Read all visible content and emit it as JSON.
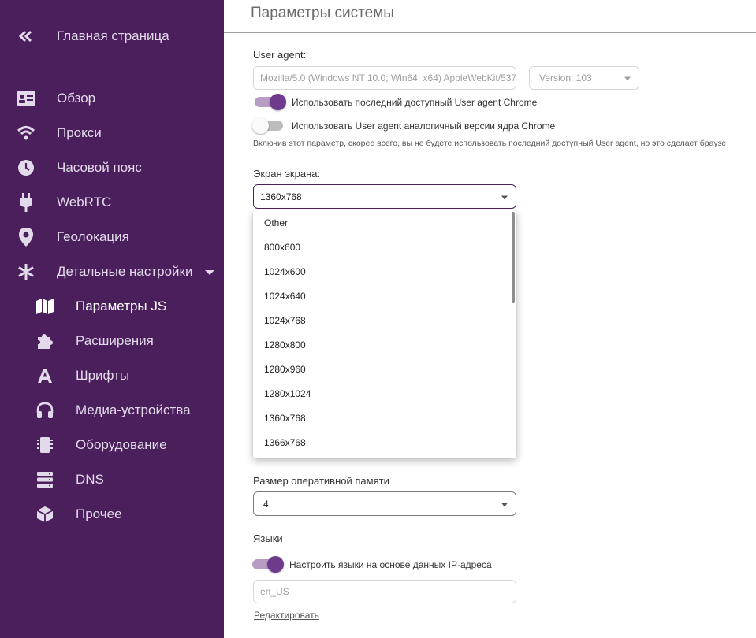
{
  "sidebar": {
    "home": {
      "label": "Главная страница",
      "icon": "double-chevron-left-icon"
    },
    "items": [
      {
        "label": "Обзор",
        "icon": "id-card-icon"
      },
      {
        "label": "Прокси",
        "icon": "wifi-icon"
      },
      {
        "label": "Часовой пояс",
        "icon": "clock-icon"
      },
      {
        "label": "WebRTC",
        "icon": "plug-icon"
      },
      {
        "label": "Геолокация",
        "icon": "location-pin-icon"
      },
      {
        "label": "Детальные настройки",
        "icon": "asterisk-icon"
      }
    ],
    "sub_items": [
      {
        "label": "Параметры JS",
        "icon": "map-icon",
        "active": true
      },
      {
        "label": "Расширения",
        "icon": "puzzle-icon"
      },
      {
        "label": "Шрифты",
        "icon": "font-icon"
      },
      {
        "label": "Медиа-устройства",
        "icon": "headphones-icon"
      },
      {
        "label": "Оборудование",
        "icon": "chip-icon"
      },
      {
        "label": "DNS",
        "icon": "server-icon"
      },
      {
        "label": "Прочее",
        "icon": "box-icon"
      }
    ]
  },
  "main": {
    "title": "Параметры системы",
    "user_agent": {
      "label": "User agent:",
      "value": "Mozilla/5.0 (Windows NT 10.0; Win64; x64) AppleWebKit/537",
      "version_value": "Version: 103",
      "toggle_latest": {
        "label": "Использовать последний доступный User agent Chrome",
        "on": true
      },
      "toggle_core": {
        "label": "Использовать User agent аналогичный версии ядра Chrome",
        "on": false
      },
      "hint": "Включив этот параметр, скорее всего, вы не будете использовать последний доступный User agent, но это сделает браузе"
    },
    "screen": {
      "label": "Экран экрана:",
      "value": "1360x768",
      "options": [
        "Other",
        "800x600",
        "1024x600",
        "1024x640",
        "1024x768",
        "1280x800",
        "1280x960",
        "1280x1024",
        "1360x768",
        "1366x768"
      ]
    },
    "ram": {
      "label": "Размер оперативной памяти",
      "value": "4"
    },
    "languages": {
      "label": "Языки",
      "toggle_ip": {
        "label": "Настроить языки на основе данных IP-адреса",
        "on": true
      },
      "value": "en_US",
      "edit_link": "Редактировать"
    }
  },
  "colors": {
    "sidebar_bg": "#4a1f5c",
    "accent": "#6e3a8c",
    "accent_light": "#b89cc4"
  }
}
